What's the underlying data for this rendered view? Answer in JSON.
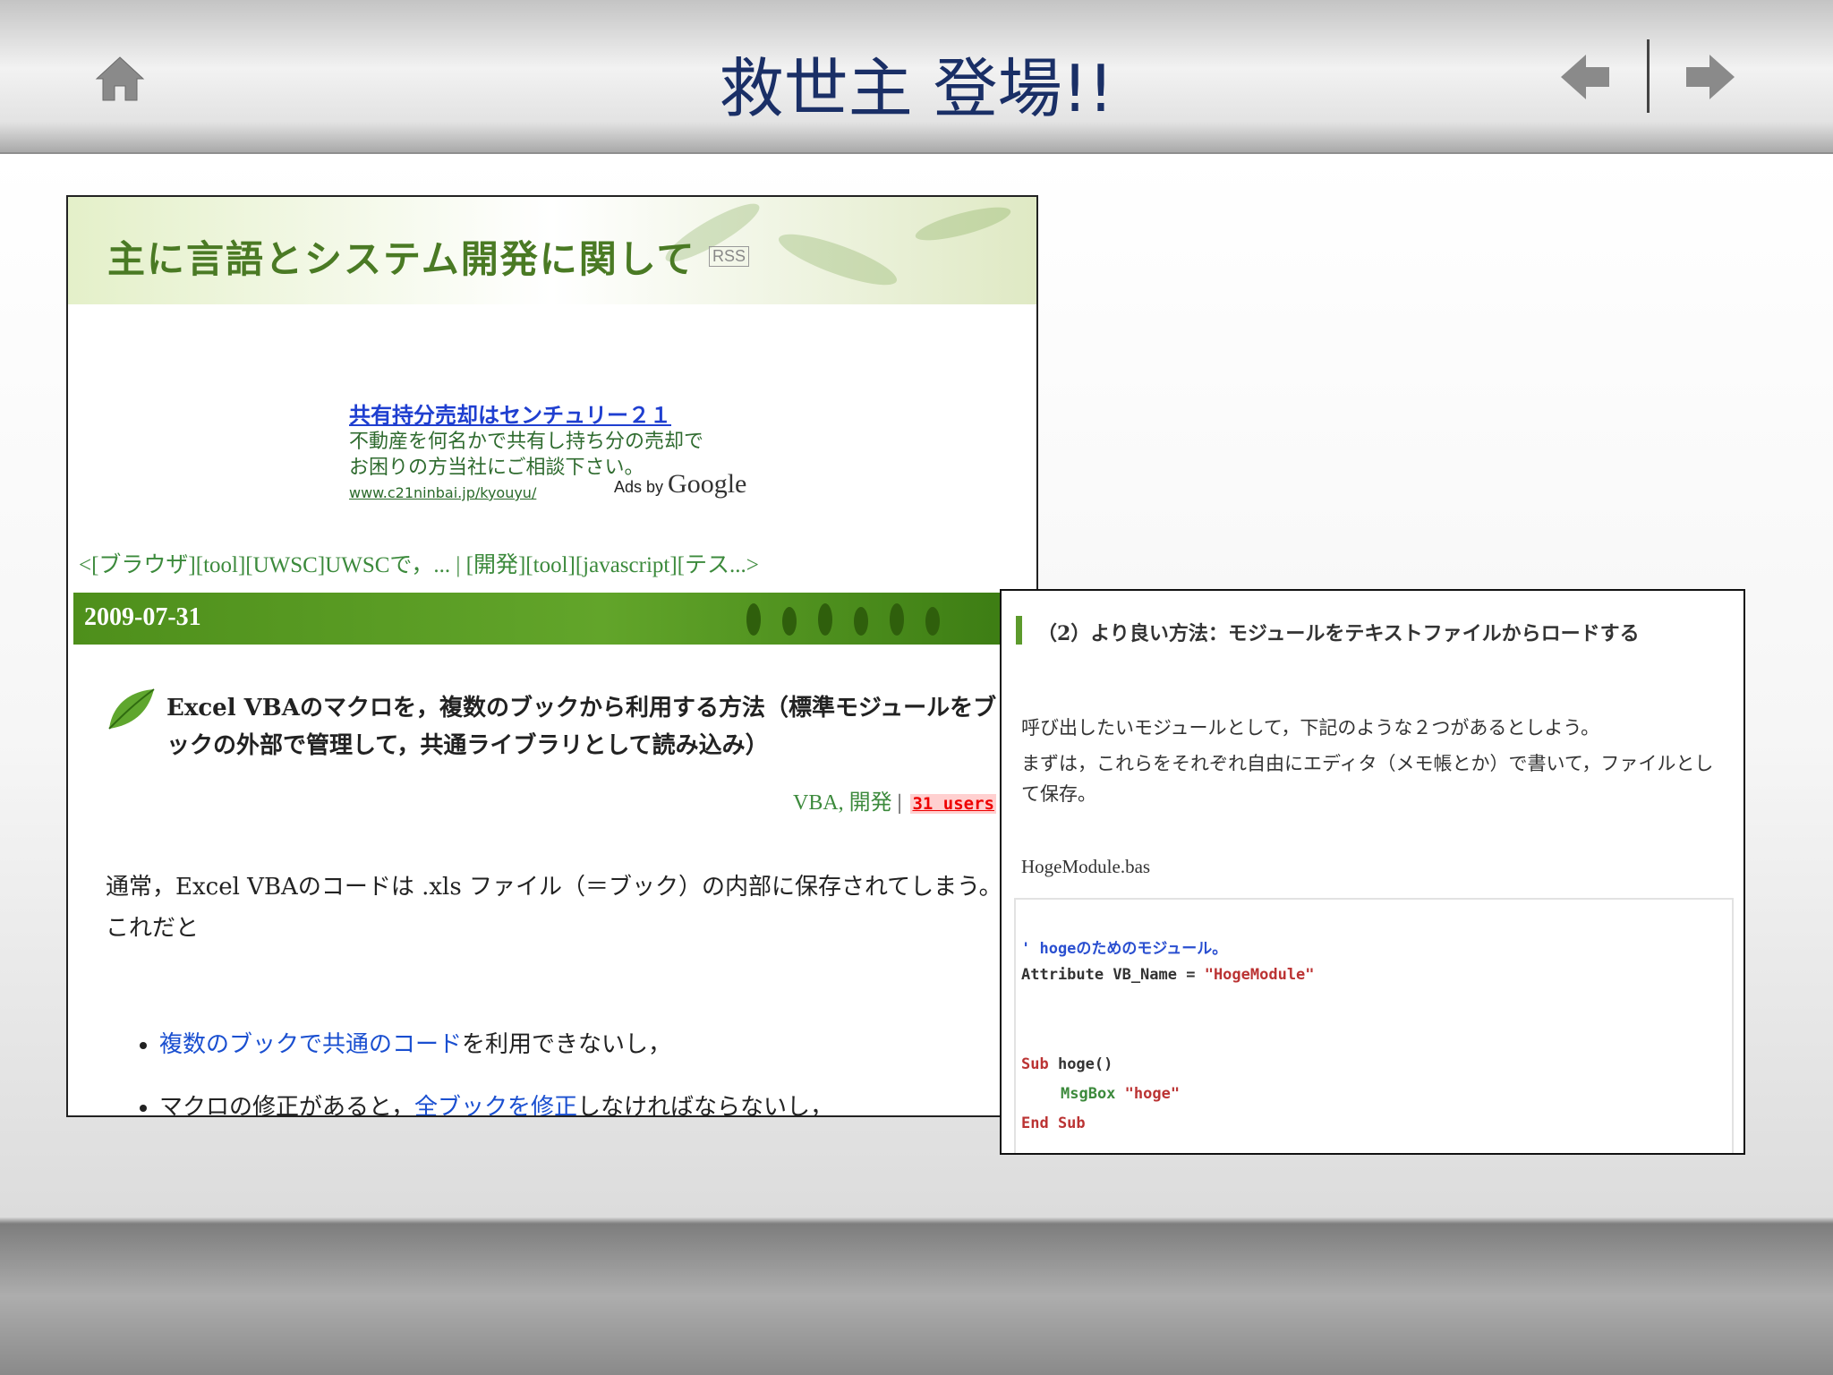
{
  "header": {
    "title": "救世主 登場!!",
    "home_icon": "home-icon",
    "prev_icon": "arrow-left-icon",
    "next_icon": "arrow-right-icon"
  },
  "blog": {
    "title": "主に言語とシステム開発に関して",
    "rss": "RSS",
    "ad": {
      "link": "共有持分売却はセンチュリー２１",
      "line1": "不動産を何名かで共有し持ち分の売却で",
      "line2": "お困りの方当社にご相談下さい。",
      "url": "www.c21ninbai.jp/kyouyu/",
      "ads_by": "Ads by",
      "google": "Google"
    },
    "nav": "<[ブラウザ][tool][UWSC]UWSCで，... | [開発][tool][javascript][テス...>",
    "date": "2009-07-31",
    "post_title": "Excel VBAのマクロを，複数のブックから利用する方法（標準モジュールをブックの外部で管理して，共通ライブラリとして読み込み）",
    "tags": "VBA, 開発",
    "tag_sep": "|",
    "users": "31 users",
    "body_line1": "通常，Excel VBAのコードは .xls ファイル（＝ブック）の内部に保存されてしまう。",
    "body_line2": "これだと",
    "bullet1_link": "複数のブックで共通のコード",
    "bullet1_rest": "を利用できないし，",
    "bullet2_pre": "マクロの修正があると，",
    "bullet2_link": "全ブックを修正",
    "bullet2_rest": "しなければならないし，"
  },
  "detail": {
    "heading": "（2）より良い方法：モジュールをテキストファイルからロードする",
    "para1": "呼び出したいモジュールとして，下記のような２つがあるとしよう。",
    "para2": "まずは，これらをそれぞれ自由にエディタ（メモ帳とか）で書いて，ファイルとして保存。",
    "filename": "HogeModule.bas",
    "code": {
      "comment": "' hogeのためのモジュール。",
      "attr_kw": "Attribute VB_Name = ",
      "attr_val": "\"HogeModule\"",
      "sub_kw": "Sub",
      "sub_name": " hoge()",
      "msgbox": "MsgBox",
      "msg_str": " \"hoge\"",
      "end_sub": "End Sub"
    }
  },
  "colors": {
    "title": "#1a2f66",
    "blog_green": "#4a7a24",
    "link_blue": "#1a4fd0",
    "date_bar": "#4e8f1b"
  }
}
